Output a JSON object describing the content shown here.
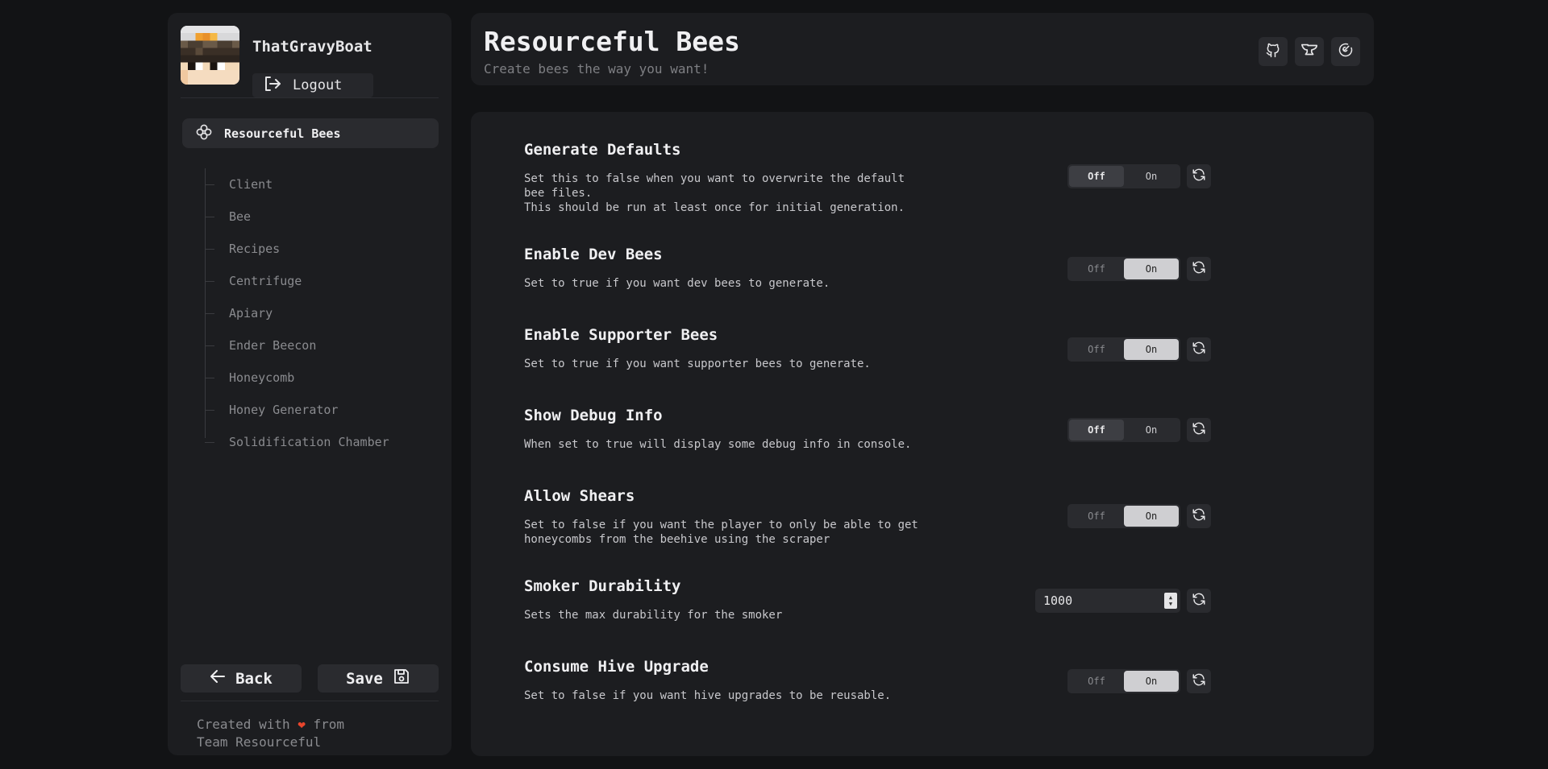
{
  "user": {
    "name": "ThatGravyBoat",
    "logout_label": "Logout"
  },
  "nav": {
    "main_label": "Resourceful Bees",
    "items": [
      "Client",
      "Bee",
      "Recipes",
      "Centrifuge",
      "Apiary",
      "Ender Beecon",
      "Honeycomb",
      "Honey Generator",
      "Solidification Chamber"
    ]
  },
  "buttons": {
    "back": "Back",
    "save": "Save"
  },
  "footer": {
    "line1_prefix": "Created with",
    "heart": "❤",
    "line1_suffix": "from",
    "line2": "Team Resourceful"
  },
  "header": {
    "title": "Resourceful Bees",
    "subtitle": "Create bees the way you want!",
    "icons": [
      "github-icon",
      "anvil-icon",
      "modrinth-icon"
    ]
  },
  "settings": [
    {
      "title": "Generate Defaults",
      "desc": "Set this to false when you want to overwrite the default\nbee files.\nThis should be run at least once for initial generation.",
      "type": "toggle",
      "value": false,
      "off": "Off",
      "on": "On"
    },
    {
      "title": "Enable Dev Bees",
      "desc": "Set to true if you want dev bees to generate.",
      "type": "toggle",
      "value": true,
      "off": "Off",
      "on": "On"
    },
    {
      "title": "Enable Supporter Bees",
      "desc": "Set to true if you want supporter bees to generate.",
      "type": "toggle",
      "value": true,
      "off": "Off",
      "on": "On"
    },
    {
      "title": "Show Debug Info",
      "desc": "When set to true will display some debug info in console.",
      "type": "toggle",
      "value": false,
      "off": "Off",
      "on": "On"
    },
    {
      "title": "Allow Shears",
      "desc": "Set to false if you want the player to only be able to get\nhoneycombs from the beehive using the scraper",
      "type": "toggle",
      "value": true,
      "off": "Off",
      "on": "On"
    },
    {
      "title": "Smoker Durability",
      "desc": "Sets the max durability for the smoker",
      "type": "number",
      "value": "1000"
    },
    {
      "title": "Consume Hive Upgrade",
      "desc": "Set to false if you want hive upgrades to be reusable.",
      "type": "toggle",
      "value": true,
      "off": "Off",
      "on": "On"
    }
  ],
  "colors": {
    "background": "#121315",
    "panel": "#1c1d20",
    "accent_heart": "#e8452c"
  }
}
